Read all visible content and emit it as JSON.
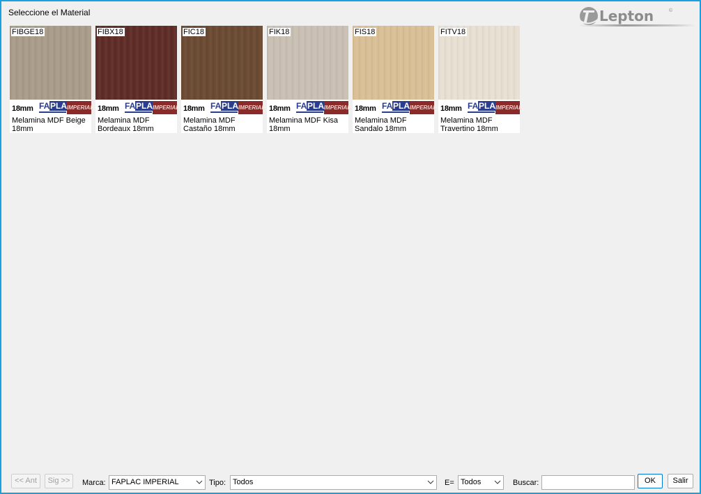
{
  "window": {
    "title": "Seleccione el Material",
    "brand": "Lepton"
  },
  "materials": [
    {
      "code": "FIBGE18",
      "thickness": "18mm",
      "brand_left": "FA",
      "brand_mid": "PLAC",
      "brand_right": "IMPERIAL",
      "desc_line1": "Melamina MDF Beige",
      "desc_line2": "18mm",
      "color": "#a99b89"
    },
    {
      "code": "FIBX18",
      "thickness": "18mm",
      "brand_left": "FA",
      "brand_mid": "PLAC",
      "brand_right": "IMPERIAL",
      "desc_line1": "Melamina MDF",
      "desc_line2": "Bordeaux 18mm",
      "color": "#5e2c27"
    },
    {
      "code": "FIC18",
      "thickness": "18mm",
      "brand_left": "FA",
      "brand_mid": "PLAC",
      "brand_right": "IMPERIAL",
      "desc_line1": "Melamina MDF",
      "desc_line2": "Castaño 18mm",
      "color": "#6a4a32"
    },
    {
      "code": "FIK18",
      "thickness": "18mm",
      "brand_left": "FA",
      "brand_mid": "PLAC",
      "brand_right": "IMPERIAL",
      "desc_line1": "Melamina MDF Kisa",
      "desc_line2": "18mm",
      "color": "#c9bfb3"
    },
    {
      "code": "FIS18",
      "thickness": "18mm",
      "brand_left": "FA",
      "brand_mid": "PLAC",
      "brand_right": "IMPERIAL",
      "desc_line1": "Melamina MDF",
      "desc_line2": "Sandalo 18mm",
      "color": "#d9bf96"
    },
    {
      "code": "FITV18",
      "thickness": "18mm",
      "brand_left": "FA",
      "brand_mid": "PLAC",
      "brand_right": "IMPERIAL",
      "desc_line1": "Melamina MDF",
      "desc_line2": "Travertino 18mm",
      "color": "#e7e0d2"
    }
  ],
  "footer": {
    "prev_label": "<< Ant",
    "next_label": "Sig >>",
    "marca_label": "Marca:",
    "marca_value": "FAPLAC IMPERIAL",
    "tipo_label": "Tipo:",
    "tipo_value": "Todos",
    "e_label": "E=",
    "e_value": "Todos",
    "buscar_label": "Buscar:",
    "buscar_value": "",
    "ok_label": "OK",
    "salir_label": "Salir"
  }
}
